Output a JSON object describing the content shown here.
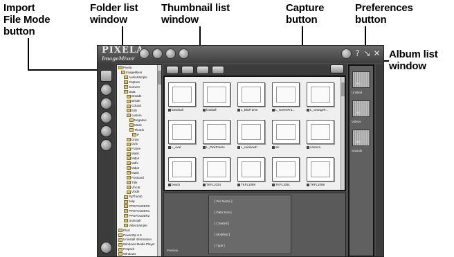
{
  "callouts": {
    "import": "Import\nFile Mode\nbutton",
    "folder": "Folder list\nwindow",
    "thumbnail": "Thumbnail list\nwindow",
    "capture": "Capture\nbutton",
    "preferences": "Preferences\nbutton",
    "album": "Album list\nwindow"
  },
  "app": {
    "logo_main": "PIXELA",
    "logo_sub": "ImageMixer"
  },
  "folder_tree": [
    "Pixela",
    "ImageMixer",
    "AudioSample",
    "Capture",
    "Convert",
    "Data",
    "Bread4",
    "Bristle",
    "Cdcat4",
    "Edit",
    "custom",
    "Negative",
    "Mask",
    "Thumb",
    "P",
    "Draw",
    "Dvfx",
    "Frame",
    "Mask",
    "Mdp4",
    "Mdfx",
    "Mdp4",
    "Mask",
    "Postcard",
    "Title",
    "Vfxcat",
    "Vfxdir",
    "PgThumb",
    "help",
    "PPGFOLDER0",
    "PPGFOLDER1",
    "PPGFOLDER2",
    "Uninstall",
    "VideoSample",
    "Plus!",
    "PowerZip 6.0",
    "Uninstall Information",
    "Windows Media Player",
    "Potpack",
    "Windows"
  ],
  "thumbnails": [
    "baseball",
    "football",
    "L_BluFrame",
    "L_GreenFra...",
    "L_OrangeF...",
    "L_oval",
    "L_PinkFrame",
    "L_rainbowF...",
    "ski",
    "camera",
    "beach",
    "TKFL1024",
    "TKFL1069",
    "TKFL1091",
    "TKFL1098"
  ],
  "info": {
    "lines": [
      "[ File Name ]",
      "[ Data Size ]",
      "[ Created ]",
      "[ Modified ]",
      "[ Type ]"
    ],
    "preview_label": "Preview"
  },
  "albums": [
    {
      "label": "Untitled",
      "count": "0/0"
    },
    {
      "label": "Videos",
      "count": "0/0"
    },
    {
      "label": "Sounds",
      "count": "0/0"
    }
  ]
}
